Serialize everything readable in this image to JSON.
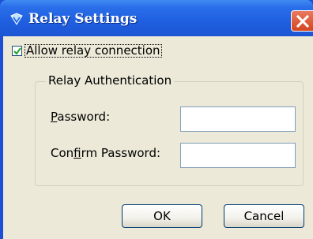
{
  "window": {
    "title": "Relay Settings",
    "accent": "#2a6ee9",
    "close_icon": "close-icon"
  },
  "relay": {
    "allow_label": "Allow relay connection",
    "allow_checked": true
  },
  "auth_group": {
    "title": "Relay Authentication",
    "password_label_prefix": "P",
    "password_label_rest": "assword:",
    "password_value": "",
    "confirm_label_prefix": "Con",
    "confirm_label_mnemonic": "f",
    "confirm_label_rest": "irm Password:",
    "confirm_value": ""
  },
  "buttons": {
    "ok_label": "OK",
    "cancel_label": "Cancel"
  }
}
